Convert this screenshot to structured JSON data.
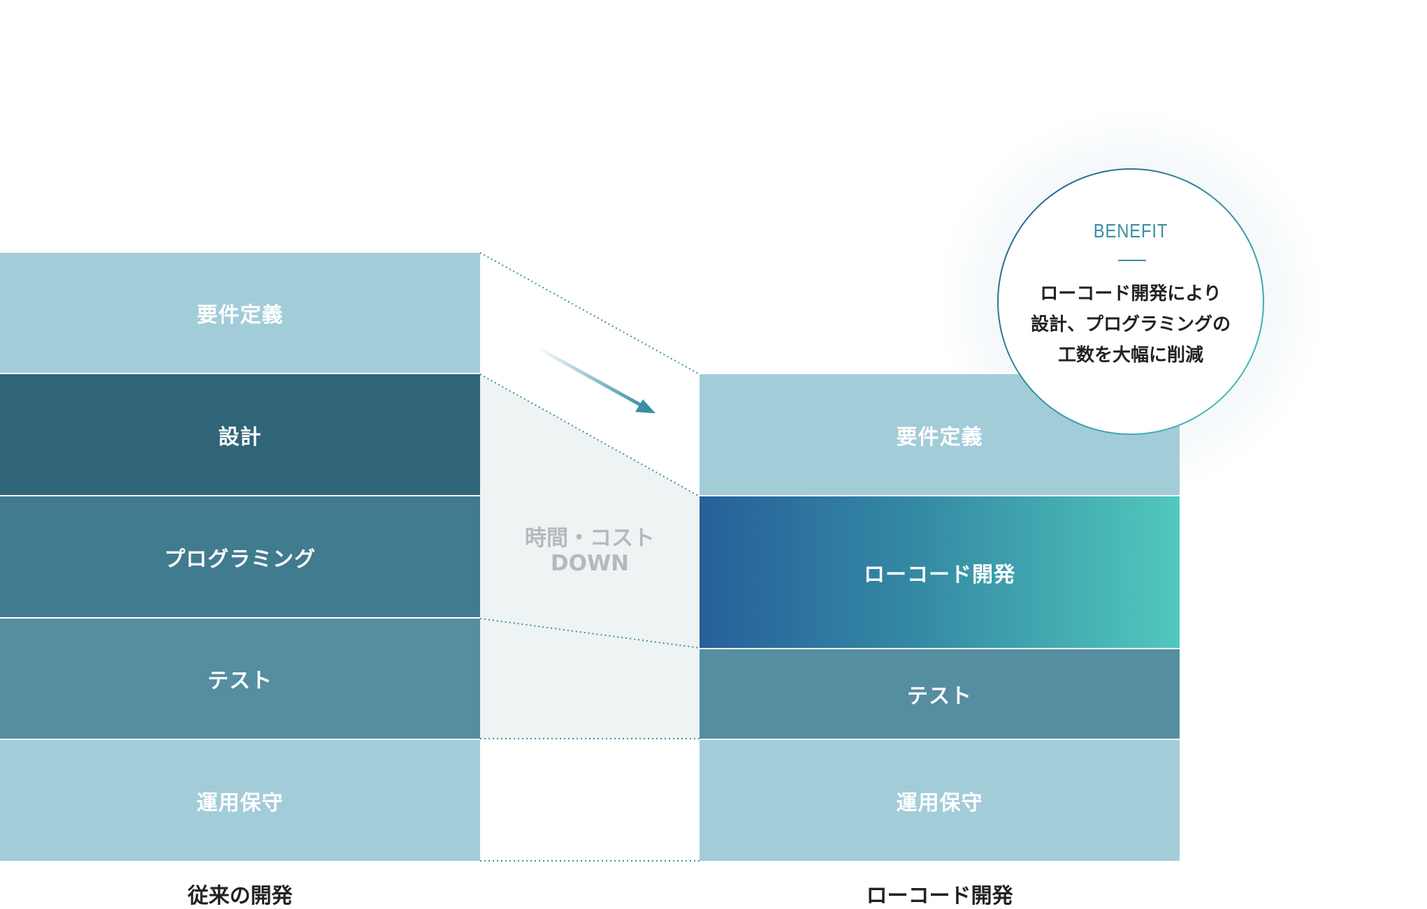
{
  "traditional": {
    "label": "従来の開発",
    "steps": [
      "要件定義",
      "設計",
      "プログラミング",
      "テスト",
      "運用保守"
    ]
  },
  "lowcode": {
    "label": "ローコード開発",
    "steps": [
      "要件定義",
      "ローコード開発",
      "テスト",
      "運用保守"
    ]
  },
  "middle": {
    "line1": "時間・コスト",
    "line2": "DOWN"
  },
  "benefit": {
    "title": "BENEFIT",
    "lines": [
      "ローコード開発により",
      "設計、プログラミングの",
      "工数を大幅に削減"
    ]
  },
  "colors": {
    "light": "#a3ccd9",
    "design": "#306477",
    "programming": "#417b8f",
    "test": "#548ea0",
    "gradient_start": "#26609a",
    "gradient_end": "#51c8bd",
    "accent": "#3a8ea3"
  }
}
